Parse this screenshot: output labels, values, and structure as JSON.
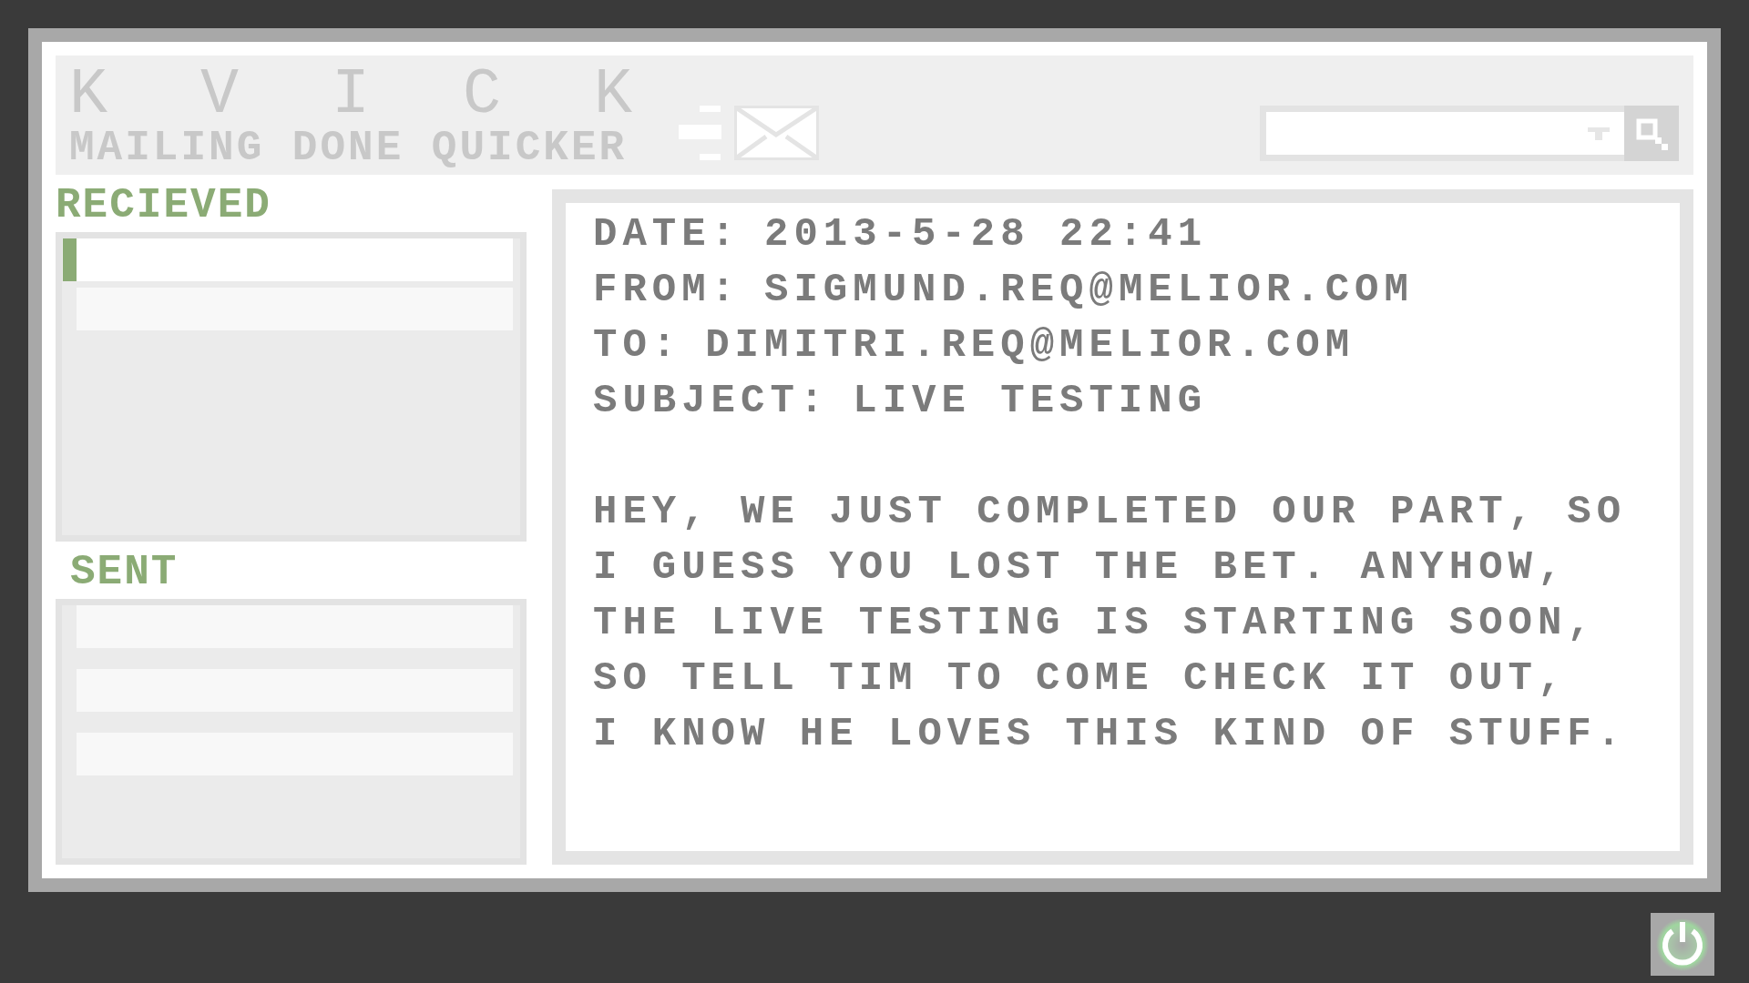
{
  "app": {
    "title": "KVICK",
    "tagline": "MAILING DONE QUICKER"
  },
  "folders": [
    {
      "kind": "received",
      "label": "RECIEVED",
      "messages": [
        {
          "selected": true
        },
        {
          "selected": false
        }
      ]
    },
    {
      "kind": "sent",
      "label": "SENT",
      "messages": [
        {
          "selected": false
        },
        {
          "selected": false
        },
        {
          "selected": false
        }
      ]
    }
  ],
  "message": {
    "headers": [
      {
        "label": "DATE:",
        "value": "2013-5-28 22:41"
      },
      {
        "label": "FROM:",
        "value": "SIGMUND.REQ@MELIOR.COM"
      },
      {
        "label": "TO:",
        "value": "DIMITRI.REQ@MELIOR.COM"
      },
      {
        "label": "SUBJECT:",
        "value": "LIVE TESTING"
      }
    ],
    "body": "HEY, WE JUST COMPLETED OUR PART, SO\nI GUESS YOU LOST THE BET. ANYHOW,\nTHE LIVE TESTING IS STARTING SOON,\nSO TELL TIM TO COME CHECK IT OUT,\nI KNOW HE LOVES THIS KIND OF STUFF."
  }
}
